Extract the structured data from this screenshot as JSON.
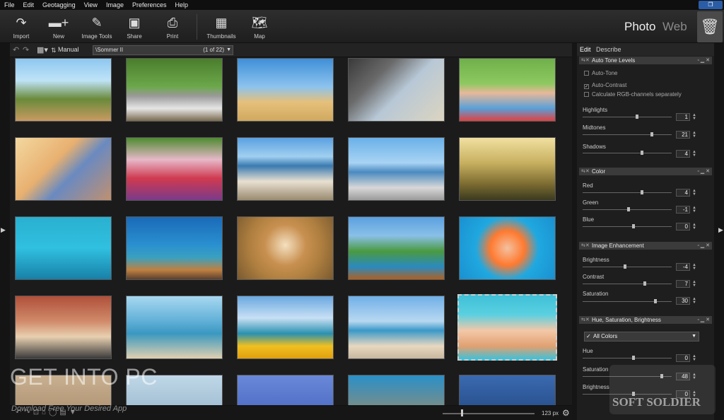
{
  "menu": [
    "File",
    "Edit",
    "Geotagging",
    "View",
    "Image",
    "Preferences",
    "Help"
  ],
  "toolbar": {
    "import": "Import",
    "new": "New",
    "image_tools": "Image Tools",
    "share": "Share",
    "print": "Print",
    "thumbnails": "Thumbnails",
    "map": "Map"
  },
  "modes": {
    "photo": "Photo",
    "web": "Web"
  },
  "gallery": {
    "sort_label": "Manual",
    "path": "\\Sommer II",
    "count": "(1 of 22)",
    "zoom_value": "123",
    "zoom_unit": "px"
  },
  "panel": {
    "tabs": {
      "edit": "Edit",
      "describe": "Describe"
    },
    "auto_tone": {
      "title": "Auto Tone Levels",
      "auto_tone": "Auto-Tone",
      "auto_contrast": "Auto-Contrast",
      "calc_rgb": "Calculate RGB-channels separately",
      "auto_tone_checked": false,
      "auto_contrast_checked": true,
      "calc_rgb_checked": false
    },
    "highlights": {
      "label": "Highlights",
      "value": "1"
    },
    "midtones": {
      "label": "Midtones",
      "value": "21"
    },
    "shadows": {
      "label": "Shadows",
      "value": "4"
    },
    "color": {
      "title": "Color"
    },
    "red": {
      "label": "Red",
      "value": "4"
    },
    "green": {
      "label": "Green",
      "value": "-1"
    },
    "blue": {
      "label": "Blue",
      "value": "0"
    },
    "enhancement": {
      "title": "Image Enhancement"
    },
    "brightness": {
      "label": "Brightness",
      "value": "-4"
    },
    "contrast": {
      "label": "Contrast",
      "value": "7"
    },
    "saturation": {
      "label": "Saturation",
      "value": "30"
    },
    "hsb": {
      "title": "Hue, Saturation, Brightness",
      "channel": "All Colors"
    },
    "hue": {
      "label": "Hue",
      "value": "0"
    },
    "hsb_saturation": {
      "label": "Saturation",
      "value": "48"
    },
    "hsb_brightness": {
      "label": "Brightness",
      "value": "0"
    }
  },
  "watermarks": {
    "get_into_pc": "GET INTO PC",
    "tagline": "Download Free Your Desired App",
    "soft_soldier": "SOFT SOLDIER"
  },
  "colors": {
    "accent": "#2b5da6",
    "background": "#1b1b1b"
  }
}
